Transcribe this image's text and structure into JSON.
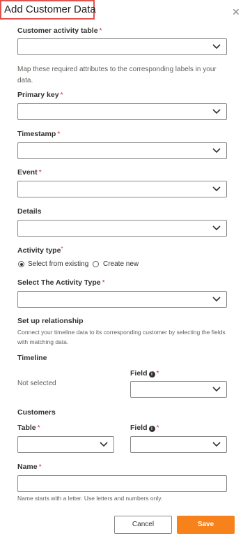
{
  "panel": {
    "title": "Add Customer Data",
    "close_glyph": "✕"
  },
  "fields": {
    "activity_table": {
      "label": "Customer activity table",
      "required": "*",
      "value": ""
    },
    "map_help": "Map these required attributes to the corresponding labels in your data.",
    "primary_key": {
      "label": "Primary key",
      "required": "*",
      "value": ""
    },
    "timestamp": {
      "label": "Timestamp",
      "required": "*",
      "value": ""
    },
    "event": {
      "label": "Event",
      "required": "*",
      "value": ""
    },
    "details": {
      "label": "Details",
      "value": ""
    },
    "activity_type": {
      "label": "Activity type",
      "required": "*",
      "options": [
        {
          "label": "Select from existing",
          "selected": true
        },
        {
          "label": "Create new",
          "selected": false
        }
      ]
    },
    "select_activity_type": {
      "label": "Select The Activity Type",
      "required": "*",
      "value": ""
    }
  },
  "relationship": {
    "heading": "Set up relationship",
    "help": "Connect your timeline data to its corresponding customer by selecting the fields with matching data.",
    "timeline": {
      "heading": "Timeline",
      "not_selected": "Not selected",
      "field": {
        "label": "Field",
        "required": "*",
        "icon": "info-icon",
        "value": ""
      }
    },
    "customers": {
      "heading": "Customers",
      "table": {
        "label": "Table",
        "required": "*",
        "value": ""
      },
      "field": {
        "label": "Field",
        "required": "*",
        "icon": "info-icon",
        "value": ""
      }
    }
  },
  "name": {
    "label": "Name",
    "required": "*",
    "value": "",
    "hint": "Name starts with a letter. Use letters and numbers only."
  },
  "footer": {
    "cancel_label": "Cancel",
    "save_label": "Save"
  },
  "colors": {
    "accent": "#f7821b",
    "required": "#c4314b",
    "highlight_border": "#e0534f"
  }
}
